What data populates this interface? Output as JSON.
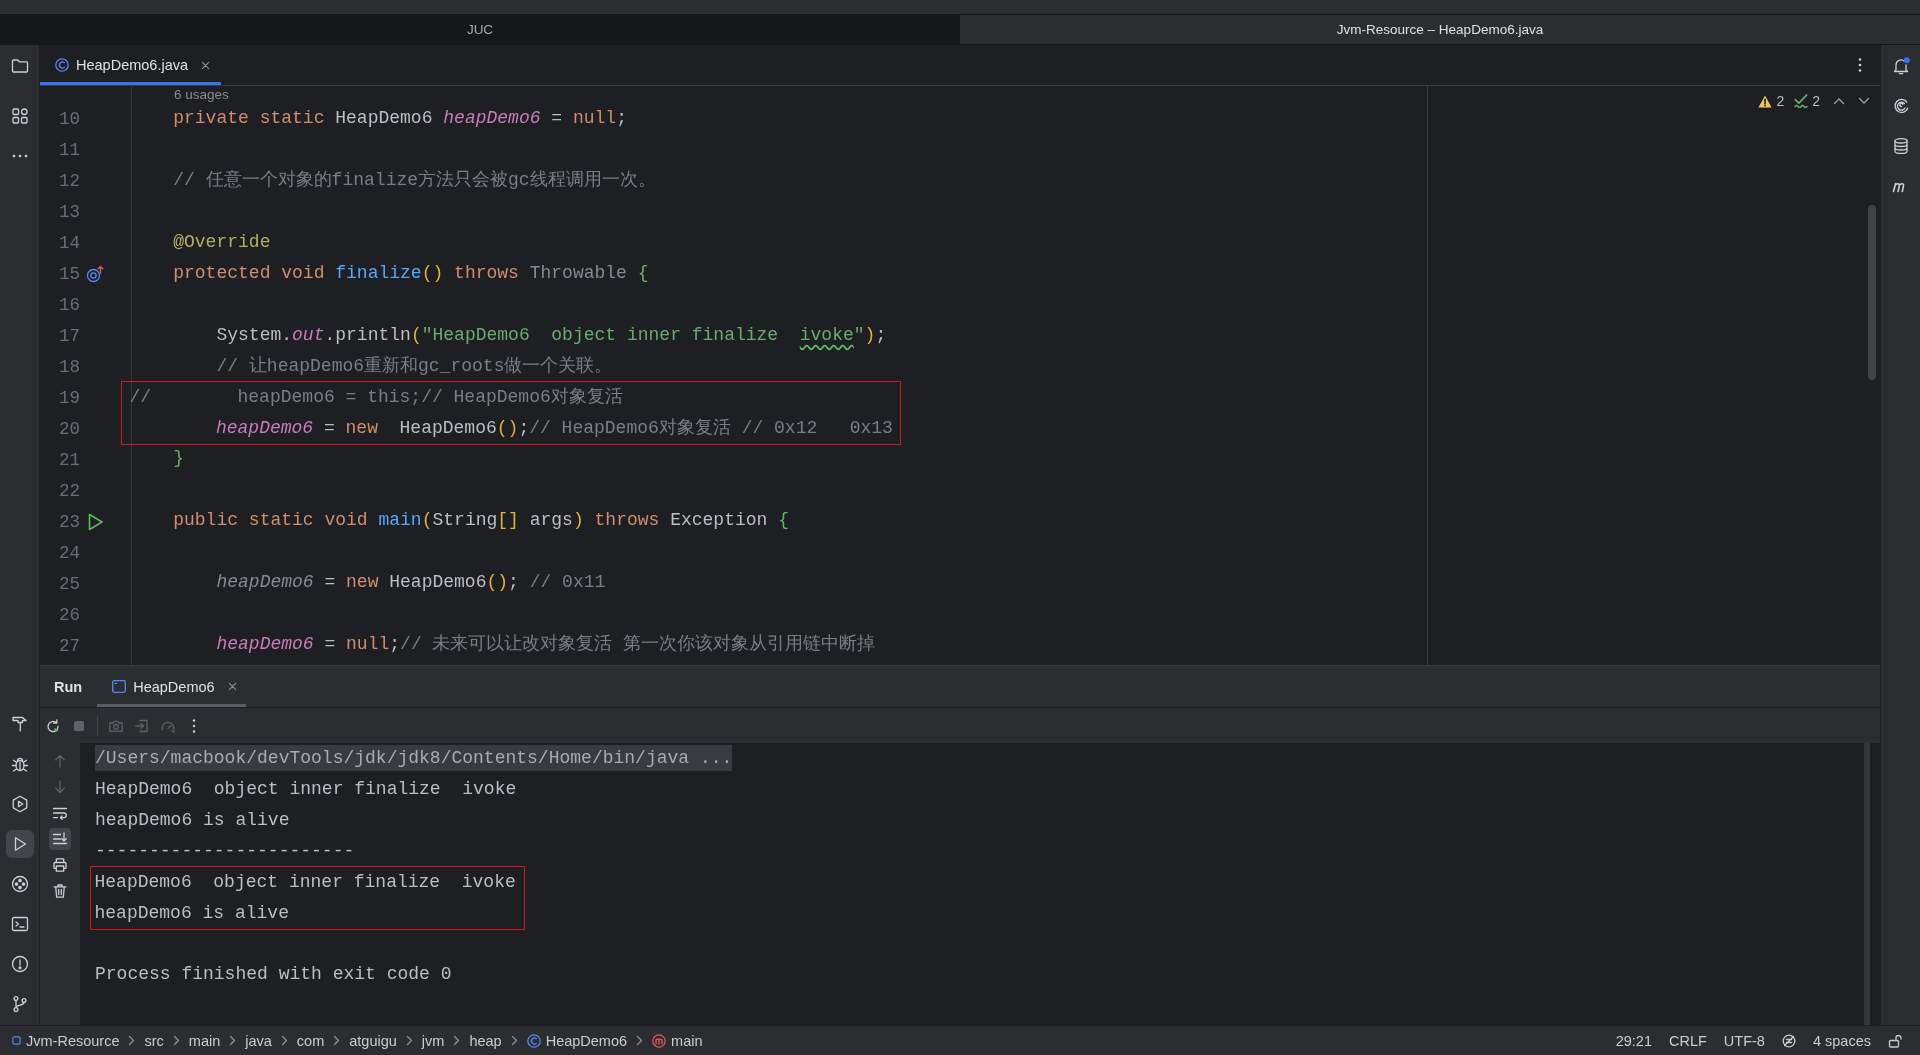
{
  "window_tabs": [
    {
      "label": "JUC",
      "selected": false
    },
    {
      "label": "Jvm-Resource – HeapDemo6.java",
      "selected": true
    }
  ],
  "left_toolbar": {
    "top": [
      {
        "selected": false
      },
      {
        "selected": false
      }
    ],
    "bottom": [
      {
        "selected": false
      },
      {
        "selected": false
      },
      {
        "selected": false
      },
      {
        "selected": true
      },
      {
        "selected": false
      },
      {
        "selected": false
      },
      {
        "selected": false
      },
      {
        "selected": false
      }
    ]
  },
  "right_toolbar": {
    "notifications": {
      "unread": true
    }
  },
  "editor_tabs": [
    {
      "label": "HeapDemo6.java",
      "selected": true
    }
  ],
  "editor": {
    "usages": "6 usages",
    "inspections": {
      "warnings": "2",
      "typos": "2"
    },
    "lines": [
      {
        "number": "10",
        "kind": "code",
        "annotated": false,
        "tokens": [
          {
            "kind": "keyword",
            "text": "    private static "
          },
          {
            "kind": "plain",
            "text": "HeapDemo6 "
          },
          {
            "kind": "field",
            "text": "heapDemo6"
          },
          {
            "kind": "plain",
            "text": " = "
          },
          {
            "kind": "keyword",
            "text": "null"
          },
          {
            "kind": "plain",
            "text": ";"
          }
        ]
      },
      {
        "number": "11",
        "kind": "code",
        "annotated": false
      },
      {
        "number": "12",
        "kind": "code",
        "annotated": false,
        "tokens": [
          {
            "kind": "comment",
            "text": "    // 任意一个对象的finalize方法只会被gc线程调用一次。"
          }
        ]
      },
      {
        "number": "13",
        "kind": "code",
        "annotated": false
      },
      {
        "number": "14",
        "kind": "code",
        "annotated": false,
        "tokens": [
          {
            "kind": "annotation",
            "text": "    @Override"
          }
        ]
      },
      {
        "number": "15",
        "kind": "override",
        "annotated": false,
        "tokens": [
          {
            "kind": "keyword",
            "text": "    protected void "
          },
          {
            "kind": "method",
            "text": "finalize"
          },
          {
            "kind": "bracket-gold",
            "text": "()"
          },
          {
            "kind": "keyword",
            "text": " throws "
          },
          {
            "kind": "type-unused",
            "text": "Throwable"
          },
          {
            "kind": "bracket-green",
            "text": " {"
          }
        ]
      },
      {
        "number": "16",
        "kind": "code",
        "annotated": false
      },
      {
        "number": "17",
        "kind": "code",
        "annotated": false,
        "tokens": [
          {
            "kind": "plain",
            "text": "        System."
          },
          {
            "kind": "field",
            "text": "out"
          },
          {
            "kind": "plain",
            "text": ".println"
          },
          {
            "kind": "bracket-gold",
            "text": "("
          },
          {
            "kind": "string",
            "text": "\"HeapDemo6  object inner finalize  "
          },
          {
            "kind": "typo",
            "text": "ivoke"
          },
          {
            "kind": "string",
            "text": "\""
          },
          {
            "kind": "bracket-gold",
            "text": ")"
          },
          {
            "kind": "plain",
            "text": ";"
          }
        ]
      },
      {
        "number": "18",
        "kind": "code",
        "annotated": false,
        "tokens": [
          {
            "kind": "comment",
            "text": "        // 让heapDemo6重新和gc_roots做一个关联。"
          }
        ]
      },
      {
        "number": "19",
        "kind": "code",
        "annotated": true,
        "tokens": [
          {
            "kind": "comment",
            "text": "//        heapDemo6 = this;// HeapDemo6对象复活"
          }
        ]
      },
      {
        "number": "20",
        "kind": "code",
        "annotated": true,
        "tokens": [
          {
            "kind": "field",
            "text": "        heapDemo6"
          },
          {
            "kind": "plain",
            "text": " = "
          },
          {
            "kind": "keyword",
            "text": "new"
          },
          {
            "kind": "plain",
            "text": "  HeapDemo6"
          },
          {
            "kind": "bracket-gold",
            "text": "()"
          },
          {
            "kind": "plain",
            "text": ";"
          },
          {
            "kind": "comment",
            "text": "// HeapDemo6对象复活 // 0x12   0x13"
          }
        ]
      },
      {
        "number": "21",
        "kind": "code",
        "annotated": false,
        "tokens": [
          {
            "kind": "bracket-green",
            "text": "    }"
          }
        ]
      },
      {
        "number": "22",
        "kind": "code",
        "annotated": false
      },
      {
        "number": "23",
        "kind": "runnable",
        "annotated": false,
        "tokens": [
          {
            "kind": "keyword",
            "text": "    public static void "
          },
          {
            "kind": "method",
            "text": "main"
          },
          {
            "kind": "bracket-gold",
            "text": "("
          },
          {
            "kind": "plain",
            "text": "String"
          },
          {
            "kind": "bracket-gold",
            "text": "[]"
          },
          {
            "kind": "plain",
            "text": " args"
          },
          {
            "kind": "bracket-gold",
            "text": ")"
          },
          {
            "kind": "keyword",
            "text": " throws "
          },
          {
            "kind": "plain",
            "text": "Exception "
          },
          {
            "kind": "bracket-green",
            "text": "{"
          }
        ]
      },
      {
        "number": "24",
        "kind": "code",
        "annotated": false
      },
      {
        "number": "25",
        "kind": "code",
        "annotated": false,
        "tokens": [
          {
            "kind": "field-unused",
            "text": "        heapDemo6"
          },
          {
            "kind": "plain",
            "text": " = "
          },
          {
            "kind": "keyword",
            "text": "new"
          },
          {
            "kind": "plain",
            "text": " HeapDemo6"
          },
          {
            "kind": "bracket-gold",
            "text": "()"
          },
          {
            "kind": "plain",
            "text": "; "
          },
          {
            "kind": "comment",
            "text": "// 0x11"
          }
        ]
      },
      {
        "number": "26",
        "kind": "code",
        "annotated": false
      },
      {
        "number": "27",
        "kind": "code",
        "annotated": false,
        "tokens": [
          {
            "kind": "field",
            "text": "        heapDemo6"
          },
          {
            "kind": "plain",
            "text": " = "
          },
          {
            "kind": "keyword",
            "text": "null"
          },
          {
            "kind": "plain",
            "text": ";"
          },
          {
            "kind": "comment",
            "text": "// 未来可以让改对象复活 第一次你该对象从引用链中断掉"
          }
        ]
      }
    ]
  },
  "run_panel": {
    "title": "Run",
    "tabs": [
      {
        "label": "HeapDemo6",
        "selected": true
      }
    ],
    "toolbar": [
      {
        "disabled": false
      },
      {
        "disabled": true
      },
      {
        "disabled": true
      },
      {
        "disabled": true
      },
      {
        "disabled": true
      }
    ],
    "console_tools": {
      "scroll_up": {
        "disabled": true
      },
      "scroll_down": {
        "disabled": true
      },
      "soft_wrap": {
        "on": false
      },
      "scroll_to_end": {
        "on": true
      }
    },
    "console": [
      {
        "kind": "command",
        "text": "/Users/macbook/devTools/jdk/jdk8/Contents/Home/bin/java ...",
        "annotated": false
      },
      {
        "kind": "output",
        "text": "HeapDemo6  object inner finalize  ivoke",
        "annotated": false
      },
      {
        "kind": "output",
        "text": "heapDemo6 is alive",
        "annotated": false
      },
      {
        "kind": "output",
        "text": "------------------------",
        "annotated": false
      },
      {
        "kind": "output",
        "text": "HeapDemo6  object inner finalize  ivoke",
        "annotated": true
      },
      {
        "kind": "output",
        "text": "heapDemo6 is alive",
        "annotated": true
      },
      {
        "kind": "blank",
        "annotated": false
      },
      {
        "kind": "output",
        "text": "Process finished with exit code 0",
        "annotated": false
      }
    ]
  },
  "status_bar": {
    "breadcrumbs": [
      {
        "label": "Jvm-Resource",
        "kind": "module"
      },
      {
        "label": "src",
        "kind": "folder"
      },
      {
        "label": "main",
        "kind": "folder"
      },
      {
        "label": "java",
        "kind": "folder"
      },
      {
        "label": "com",
        "kind": "folder"
      },
      {
        "label": "atguigu",
        "kind": "folder"
      },
      {
        "label": "jvm",
        "kind": "folder"
      },
      {
        "label": "heap",
        "kind": "folder"
      },
      {
        "label": "HeapDemo6",
        "kind": "class"
      },
      {
        "label": "main",
        "kind": "method"
      }
    ],
    "caret": "29:21",
    "line_separator": "CRLF",
    "encoding": "UTF-8",
    "indent": "4 spaces"
  }
}
